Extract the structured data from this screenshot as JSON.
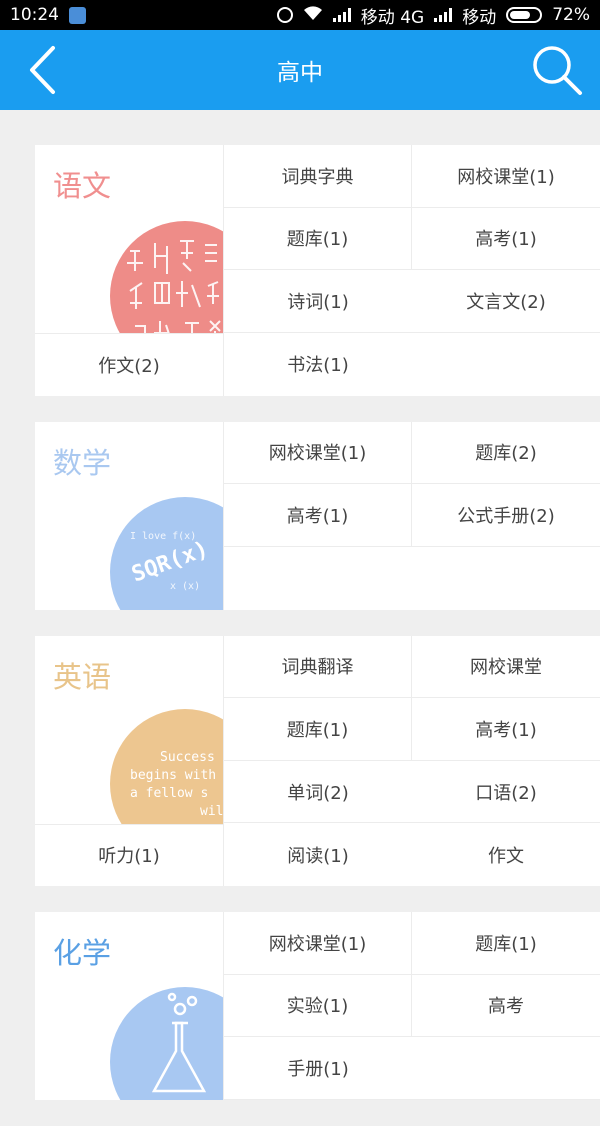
{
  "status_bar": {
    "time": "10:24",
    "carrier1": "移动 4G",
    "carrier2": "移动",
    "battery": "72%",
    "battery_level": 0.72
  },
  "nav": {
    "back_icon": "chevron-left-icon",
    "title": "高中",
    "search_icon": "search-icon"
  },
  "colors": {
    "nav_bg": "#1a9df0",
    "chinese": "#f08f8f",
    "math": "#a9c8f0",
    "english": "#e8c48a",
    "chemistry": "#5aa0e4"
  },
  "subjects": [
    {
      "name": "语文",
      "deco_text": "",
      "items": [
        "词典字典",
        "网校课堂(1)",
        "题库(1)",
        "高考(1)",
        "诗词(1)",
        "文言文(2)",
        "作文(2)",
        "书法(1)",
        ""
      ]
    },
    {
      "name": "数学",
      "deco_text": "SQR(x)",
      "items": [
        "网校课堂(1)",
        "题库(2)",
        "高考(1)",
        "公式手册(2)",
        "",
        ""
      ]
    },
    {
      "name": "英语",
      "deco_text": [
        "Success",
        "begins with",
        "a fellow s",
        "will"
      ],
      "items": [
        "词典翻译",
        "网校课堂",
        "题库(1)",
        "高考(1)",
        "单词(2)",
        "口语(2)",
        "听力(1)",
        "阅读(1)",
        "作文"
      ]
    },
    {
      "name": "化学",
      "deco_text": "",
      "items": [
        "网校课堂(1)",
        "题库(1)",
        "实验(1)",
        "高考",
        "手册(1)",
        ""
      ]
    }
  ]
}
